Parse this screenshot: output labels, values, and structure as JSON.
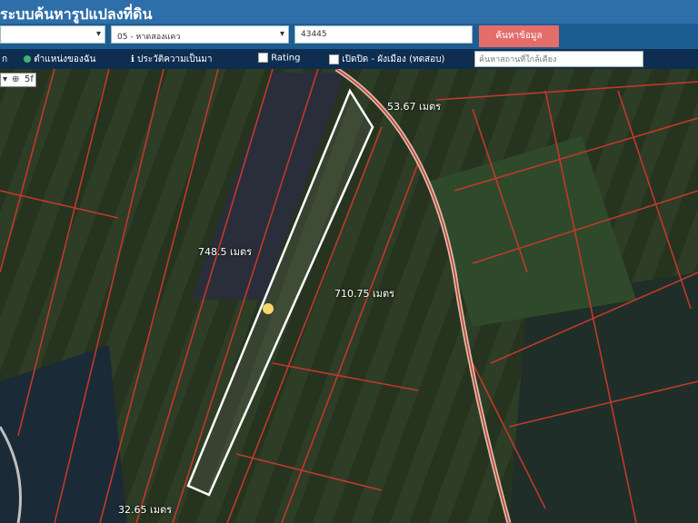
{
  "header": {
    "title": "ระบบค้นหารูปแปลงที่ดิน"
  },
  "search": {
    "province_value": "",
    "district_value": "05 - หาดสองแคว",
    "parcel_value": "43445",
    "search_button": "ค้นหาข้อมูล"
  },
  "toolbar": {
    "item1": "ก",
    "item2": "ตำแหน่งของฉัน",
    "item3": "ประวัติความเป็นมา",
    "item4": "Rating",
    "item5": "เปิดปิด - ผังเมือง (ทดสอบ)",
    "search_placeholder": "ค้นหาสถานที่ใกล้เคียง"
  },
  "map": {
    "zoom_label": "5f",
    "labels": {
      "top": "53.67 เมตร",
      "left": "748.5 เมตร",
      "right": "710.75 เมตร",
      "bottom": "32.65 เมตร"
    },
    "colors": {
      "parcel_line": "#c0392b",
      "selected_outline": "#ffffff",
      "header": "#2f6fa9",
      "button": "#e46d6a"
    }
  }
}
